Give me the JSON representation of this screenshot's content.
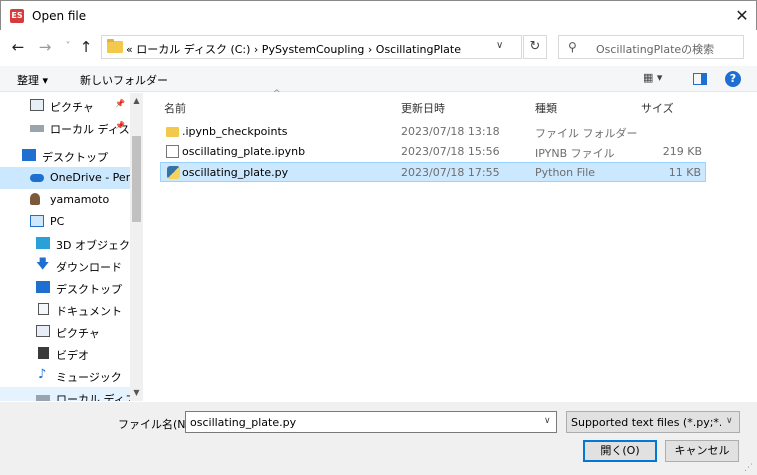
{
  "window": {
    "app_icon_text": "ES",
    "title": "Open file",
    "close_glyph": "✕"
  },
  "nav": {
    "back_glyph": "←",
    "forward_glyph": "→",
    "recent_glyph": "˅",
    "up_glyph": "↑",
    "address_path": "« ローカル ディスク (C:)  ›  PySystemCoupling  ›  OscillatingPlate",
    "address_dropdown_glyph": "∨",
    "refresh_glyph": "↻",
    "search_glyph": "⚲",
    "search_placeholder": "OscillatingPlateの検索"
  },
  "toolbar": {
    "organize_label": "整理 ▾",
    "new_folder_label": "新しいフォルダー",
    "view_label": "▦ ▾",
    "help_label": "?"
  },
  "sidebar": {
    "items": [
      {
        "label": "ピクチャ",
        "pin": "📌",
        "icon": "pictures-icon"
      },
      {
        "label": "ローカル ディスク",
        "pin": "📌",
        "icon": "drive-icon"
      },
      {
        "label": "デスクトップ",
        "icon": "desktop-icon"
      },
      {
        "label": "OneDrive - Perso",
        "icon": "onedrive-icon"
      },
      {
        "label": "yamamoto",
        "icon": "user-icon"
      },
      {
        "label": "PC",
        "icon": "pc-icon"
      },
      {
        "label": "3D オブジェクト",
        "icon": "3d-objects-icon"
      },
      {
        "label": "ダウンロード",
        "icon": "download-icon"
      },
      {
        "label": "デスクトップ",
        "icon": "desktop-icon"
      },
      {
        "label": "ドキュメント",
        "icon": "documents-icon"
      },
      {
        "label": "ピクチャ",
        "icon": "pictures-icon"
      },
      {
        "label": "ビデオ",
        "icon": "video-icon"
      },
      {
        "label": "ミュージック",
        "icon": "music-icon"
      },
      {
        "label": "ローカル ディスク(",
        "icon": "drive-icon"
      }
    ]
  },
  "files": {
    "columns": [
      "名前",
      "更新日時",
      "種類",
      "サイズ"
    ],
    "sort_glyph": "^",
    "rows": [
      {
        "name": ".ipynb_checkpoints",
        "modified": "2023/07/18 13:18",
        "type": "ファイル フォルダー",
        "size": "",
        "icon": "folder-icon"
      },
      {
        "name": "oscillating_plate.ipynb",
        "modified": "2023/07/18 15:56",
        "type": "IPYNB ファイル",
        "size": "219 KB",
        "icon": "document-icon"
      },
      {
        "name": "oscillating_plate.py",
        "modified": "2023/07/18 17:55",
        "type": "Python File",
        "size": "11 KB",
        "icon": "python-file-icon"
      }
    ]
  },
  "footer": {
    "filename_label": "ファイル名(N):",
    "filename_value": "oscillating_plate.py",
    "dropdown_glyph": "∨",
    "filetype_value": "Supported text files (*.py;*.R;*.jl",
    "open_label": "開く(O)",
    "cancel_label": "キャンセル",
    "grip_glyph": "⋰"
  }
}
